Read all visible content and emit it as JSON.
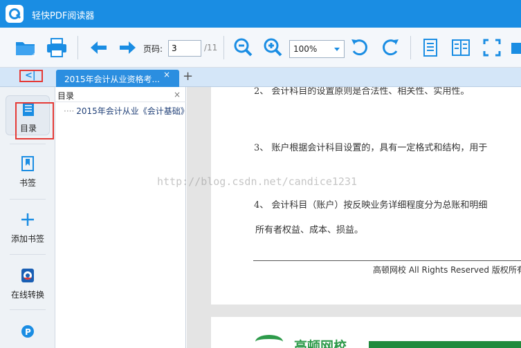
{
  "window": {
    "title": "轻快PDF阅读器"
  },
  "toolbar": {
    "page_label": "页码:",
    "page_value": "3",
    "page_total": "/11",
    "zoom_value": "100%",
    "icons": [
      "open-folder-icon",
      "print-icon",
      "back-arrow-icon",
      "forward-arrow-icon",
      "zoom-out-icon",
      "zoom-in-icon",
      "rotate-left-icon",
      "rotate-right-icon",
      "single-page-icon",
      "two-page-icon",
      "fullscreen-icon",
      "extra-icon"
    ]
  },
  "tabs": {
    "collapse_label": "<|",
    "active_tab_title": "2015年会计从业资格考...",
    "close_label": "×",
    "new_tab_label": "+"
  },
  "sidebar": {
    "items": [
      {
        "label": "目录",
        "icon": "toc-icon"
      },
      {
        "label": "书签",
        "icon": "bookmark-icon"
      },
      {
        "label": "添加书签",
        "icon": "add-bookmark-icon"
      },
      {
        "label": "在线转换",
        "icon": "online-convert-icon"
      },
      {
        "label": "",
        "icon": "pdf-convert-icon"
      }
    ]
  },
  "toc_panel": {
    "title": "目录",
    "close_label": "×",
    "entry": "2015年会计从业《会计基础》"
  },
  "document": {
    "paragraphs": [
      "2、 会计科目的设置原则是合法性、相关性、实用性。",
      "3、 账户根据会计科目设置的，具有一定格式和结构，用于",
      "4、 会计科目（账户）按反映业务详细程度分为总账和明细",
      "所有者权益、成本、损益。"
    ],
    "footer": "高顿网校  All Rights Reserved   版权所有",
    "watermark": "http://blog.csdn.net/candice1231",
    "page2_brand": "高顿网校"
  },
  "colors": {
    "title_bar": "#1a8de3",
    "accent": "#1a8de3",
    "highlight_box": "#e53935",
    "brand_green": "#2d9a4a"
  }
}
